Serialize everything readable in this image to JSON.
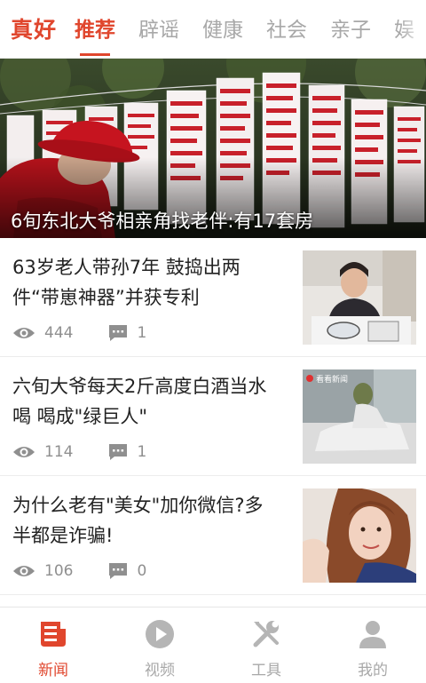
{
  "header": {
    "brand": "真好",
    "tabs": [
      {
        "label": "推荐",
        "active": true
      },
      {
        "label": "辟谣",
        "active": false
      },
      {
        "label": "健康",
        "active": false
      },
      {
        "label": "社会",
        "active": false
      },
      {
        "label": "亲子",
        "active": false
      },
      {
        "label": "娱",
        "active": false
      }
    ]
  },
  "hero": {
    "title": "6旬东北大爷相亲角找老伴:有17套房"
  },
  "news": [
    {
      "title": "63岁老人带孙7年 鼓捣出两件“带崽神器”并获专利",
      "views": "444",
      "comments": "1"
    },
    {
      "title": "六旬大爷每天2斤高度白酒当水喝 喝成\"绿巨人\"",
      "views": "114",
      "comments": "1",
      "thumb_label": "看看新闻"
    },
    {
      "title": "为什么老有\"美女\"加你微信?多半都是诈骗!",
      "views": "106",
      "comments": "0"
    }
  ],
  "bottom_nav": [
    {
      "label": "新闻",
      "icon": "news-icon",
      "active": true
    },
    {
      "label": "视频",
      "icon": "play-icon",
      "active": false
    },
    {
      "label": "工具",
      "icon": "tools-icon",
      "active": false
    },
    {
      "label": "我的",
      "icon": "user-icon",
      "active": false
    }
  ],
  "colors": {
    "accent": "#e0462d",
    "inactive": "#a8a8a8",
    "meta": "#8f8f8f"
  }
}
